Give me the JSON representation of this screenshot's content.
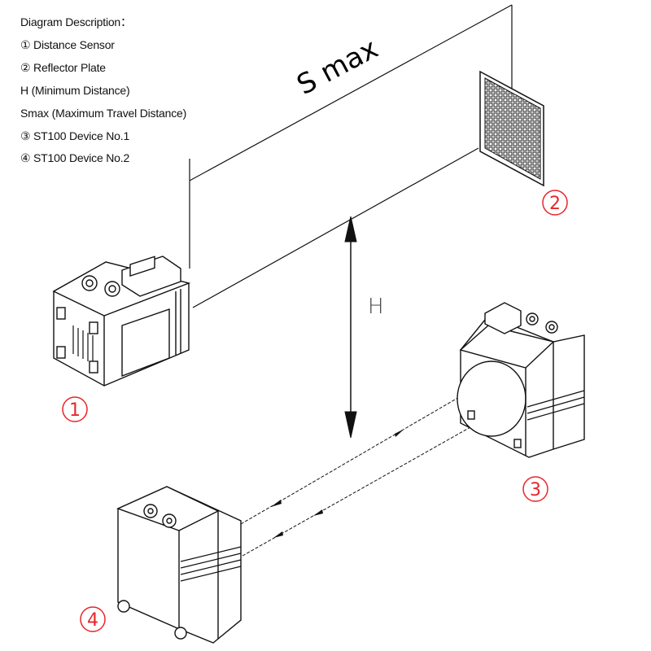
{
  "legend": {
    "title": "Diagram Description：",
    "items": [
      "① Distance Sensor",
      "② Reflector Plate",
      "H (Minimum Distance)",
      "Smax (Maximum Travel Distance)",
      "③ ST100 Device No.1",
      "④ ST100 Device No.2"
    ]
  },
  "dimensions": {
    "smax_label": "S max",
    "h_label": "H"
  },
  "callouts": [
    {
      "id": "1",
      "label": "1",
      "target": "Distance Sensor"
    },
    {
      "id": "2",
      "label": "2",
      "target": "Reflector Plate"
    },
    {
      "id": "3",
      "label": "3",
      "target": "ST100 Device No.1"
    },
    {
      "id": "4",
      "label": "4",
      "target": "ST100 Device No.2"
    }
  ],
  "colors": {
    "callout": "#e8262a",
    "line": "#111111"
  }
}
